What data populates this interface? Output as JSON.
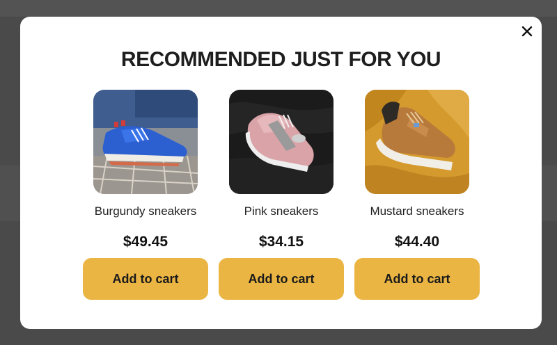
{
  "modal": {
    "title": "RECOMMENDED JUST FOR YOU",
    "close_icon": "close-icon",
    "products": [
      {
        "name": "Burgundy sneakers",
        "price": "$49.45",
        "button_label": "Add to cart",
        "image_icon": "sneaker-photo-icon"
      },
      {
        "name": "Pink sneakers",
        "price": "$34.15",
        "button_label": "Add to cart",
        "image_icon": "sneaker-photo-icon"
      },
      {
        "name": "Mustard sneakers",
        "price": "$44.40",
        "button_label": "Add to cart",
        "image_icon": "sneaker-photo-icon"
      }
    ]
  },
  "colors": {
    "overlay": "#4a4a4a",
    "modal_background": "#ffffff",
    "button_background": "#eab543",
    "text": "#1e1e1e"
  }
}
